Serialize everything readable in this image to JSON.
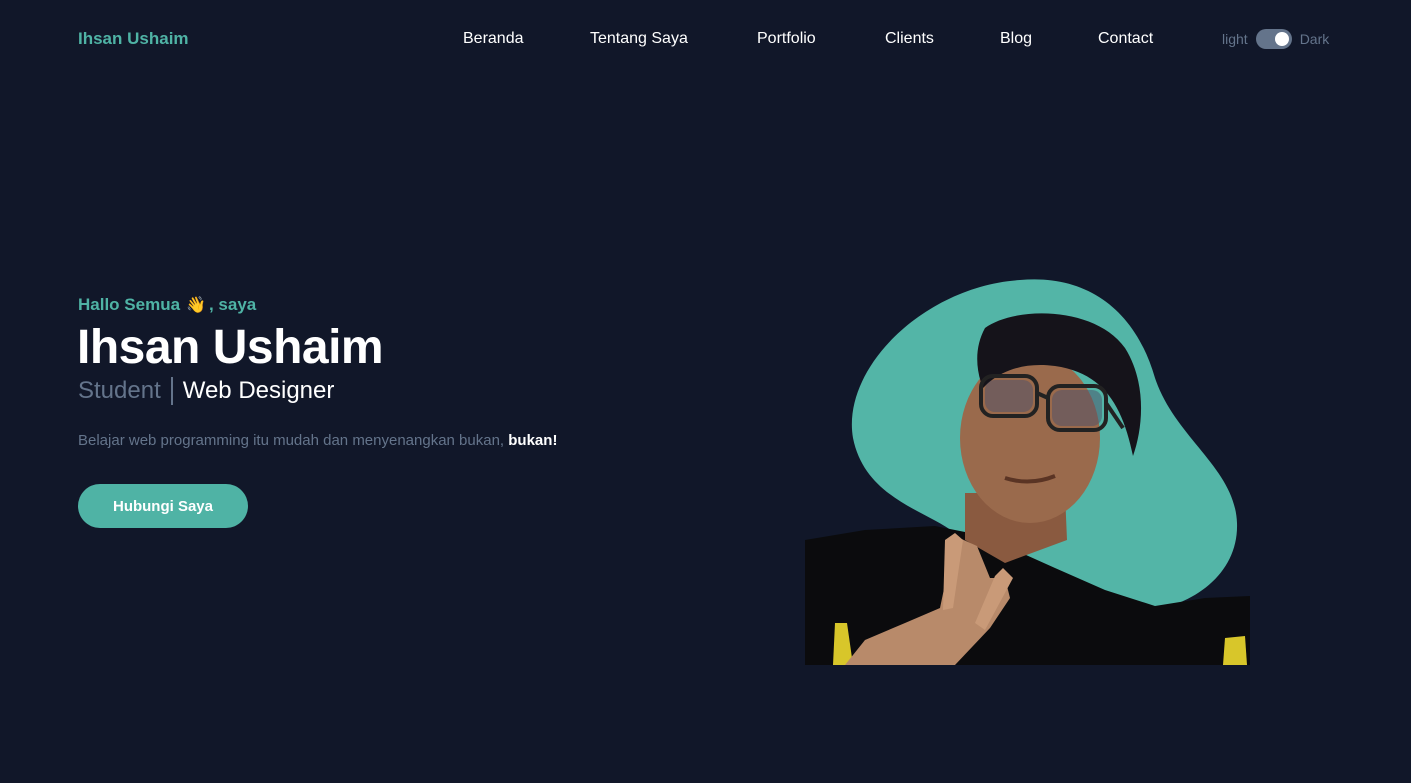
{
  "brand": "Ihsan Ushaim",
  "nav": [
    {
      "label": "Beranda"
    },
    {
      "label": "Tentang Saya"
    },
    {
      "label": "Portfolio"
    },
    {
      "label": "Clients"
    },
    {
      "label": "Blog"
    },
    {
      "label": "Contact"
    }
  ],
  "theme_toggle": {
    "light_label": "light",
    "dark_label": "Dark",
    "state": "dark"
  },
  "hero": {
    "greeting_prefix": "Hallo Semua",
    "greeting_emoji": "👋",
    "greeting_suffix": ", saya",
    "name": "Ihsan Ushaim",
    "role_primary": "Student",
    "role_secondary": "Web Designer",
    "description": "Belajar web programming itu mudah dan menyenangkan bukan,",
    "description_emphasis": "bukan!",
    "cta_label": "Hubungi Saya"
  },
  "colors": {
    "background": "#111729",
    "accent": "#4fb3a5",
    "muted": "#64748b",
    "text": "#ffffff"
  },
  "icons": {
    "greeting": "waving-hand-icon"
  }
}
